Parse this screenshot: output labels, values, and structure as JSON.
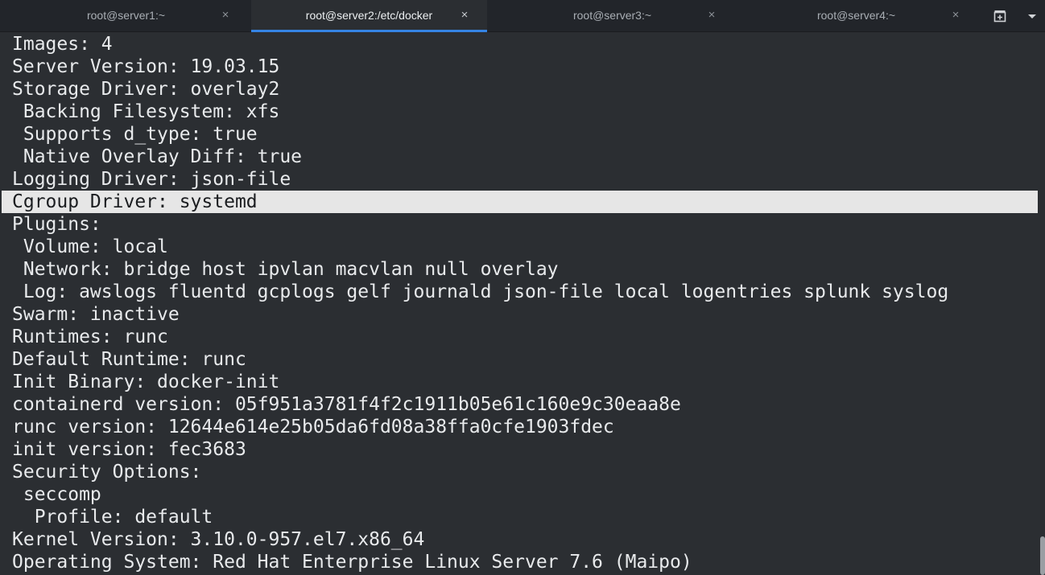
{
  "tabs": [
    {
      "label": "root@server1:~",
      "close": "×",
      "active": false
    },
    {
      "label": "root@server2:/etc/docker",
      "close": "×",
      "active": true
    },
    {
      "label": "root@server3:~",
      "close": "×",
      "active": false
    },
    {
      "label": "root@server4:~",
      "close": "×",
      "active": false
    }
  ],
  "toolbar": {
    "new_tab_icon": "new-tab-icon",
    "menu_icon": "chevron-down-icon"
  },
  "colors": {
    "accent": "#3584e4",
    "background": "#2b2e32",
    "highlight": "#e6e6e6"
  },
  "terminal": {
    "lines": [
      "Images: 4",
      "Server Version: 19.03.15",
      "Storage Driver: overlay2",
      " Backing Filesystem: xfs",
      " Supports d_type: true",
      " Native Overlay Diff: true",
      "Logging Driver: json-file",
      "Cgroup Driver: systemd",
      "Plugins:",
      " Volume: local",
      " Network: bridge host ipvlan macvlan null overlay",
      " Log: awslogs fluentd gcplogs gelf journald json-file local logentries splunk syslog",
      "Swarm: inactive",
      "Runtimes: runc",
      "Default Runtime: runc",
      "Init Binary: docker-init",
      "containerd version: 05f951a3781f4f2c1911b05e61c160e9c30eaa8e",
      "runc version: 12644e614e25b05da6fd08a38ffa0cfe1903fdec",
      "init version: fec3683",
      "Security Options:",
      " seccomp",
      "  Profile: default",
      "Kernel Version: 3.10.0-957.el7.x86_64",
      "Operating System: Red Hat Enterprise Linux Server 7.6 (Maipo)"
    ]
  }
}
